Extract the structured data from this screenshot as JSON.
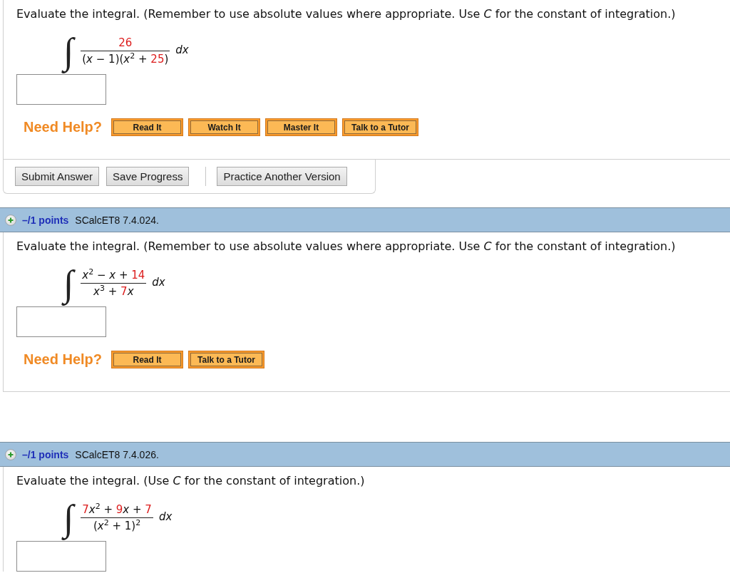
{
  "problems": [
    {
      "prompt": "Evaluate the integral. (Remember to use absolute values where appropriate. Use *C* for the constant of integration.)",
      "integral": {
        "sign": "∫",
        "numerator": [
          {
            "text": "26",
            "kind": "parameter"
          }
        ],
        "denominator": [
          {
            "text": "(",
            "kind": "text"
          },
          {
            "text": "x",
            "kind": "variable"
          },
          {
            "text": " − 1)(",
            "kind": "text"
          },
          {
            "text": "x",
            "kind": "variable"
          },
          {
            "text": "2",
            "kind": "power"
          },
          {
            "text": " + ",
            "kind": "text"
          },
          {
            "text": "25",
            "kind": "parameter"
          },
          {
            "text": ")",
            "kind": "text"
          }
        ],
        "differential": "dx"
      },
      "help": {
        "label": "Need Help?",
        "buttons": [
          "Read It",
          "Watch It",
          "Master It",
          "Talk to a Tutor"
        ]
      },
      "actions": {
        "primary": [
          "Submit Answer",
          "Save Progress"
        ],
        "secondary": [
          "Practice Another Version"
        ]
      }
    },
    {
      "header": {
        "points": "–/1 points",
        "source": "SCalcET8 7.4.024."
      },
      "prompt": "Evaluate the integral. (Remember to use absolute values where appropriate. Use *C* for the constant of integration.)",
      "integral": {
        "sign": "∫",
        "numerator": [
          {
            "text": "x",
            "kind": "variable"
          },
          {
            "text": "2",
            "kind": "power"
          },
          {
            "text": " − ",
            "kind": "text"
          },
          {
            "text": "x",
            "kind": "variable"
          },
          {
            "text": " + ",
            "kind": "text"
          },
          {
            "text": "14",
            "kind": "parameter"
          }
        ],
        "denominator": [
          {
            "text": "x",
            "kind": "variable"
          },
          {
            "text": "3",
            "kind": "power"
          },
          {
            "text": " + ",
            "kind": "text"
          },
          {
            "text": "7",
            "kind": "parameter"
          },
          {
            "text": "x",
            "kind": "variable"
          }
        ],
        "differential": "dx"
      },
      "help": {
        "label": "Need Help?",
        "buttons": [
          "Read It",
          "Talk to a Tutor"
        ]
      }
    },
    {
      "header": {
        "points": "–/1 points",
        "source": "SCalcET8 7.4.026."
      },
      "prompt": "Evaluate the integral. (Use *C* for the constant of integration.)",
      "integral": {
        "sign": "∫",
        "numerator": [
          {
            "text": "7",
            "kind": "parameter"
          },
          {
            "text": "x",
            "kind": "variable"
          },
          {
            "text": "2",
            "kind": "power"
          },
          {
            "text": " + ",
            "kind": "text"
          },
          {
            "text": "9",
            "kind": "parameter"
          },
          {
            "text": "x",
            "kind": "variable"
          },
          {
            "text": " + ",
            "kind": "text"
          },
          {
            "text": "7",
            "kind": "parameter"
          }
        ],
        "denominator": [
          {
            "text": "(",
            "kind": "text"
          },
          {
            "text": "x",
            "kind": "variable"
          },
          {
            "text": "2",
            "kind": "power"
          },
          {
            "text": " + 1)",
            "kind": "text"
          },
          {
            "text": "2",
            "kind": "power"
          }
        ],
        "differential": "dx"
      }
    }
  ]
}
